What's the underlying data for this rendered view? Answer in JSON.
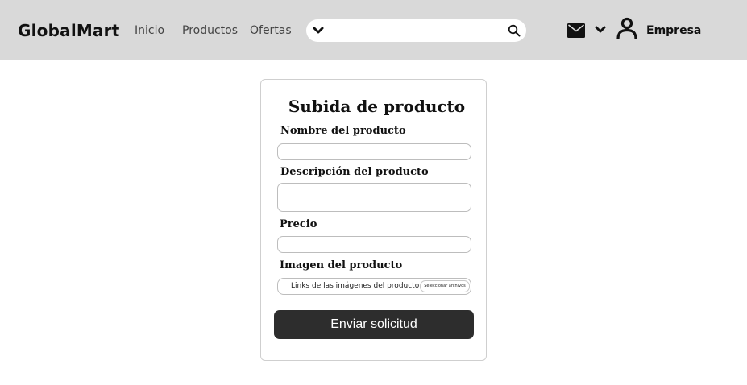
{
  "header": {
    "brand": "GlobalMart",
    "nav": [
      "Inicio",
      "Productos",
      "Ofertas"
    ],
    "search": {
      "placeholder": "",
      "value": "",
      "icons": [
        "chevron-down-icon",
        "search-icon"
      ]
    },
    "icons": [
      "mail-icon",
      "chevron-down-icon",
      "user-icon"
    ],
    "user_label": "Empresa"
  },
  "form": {
    "title": "Subida de producto",
    "fields": {
      "name": {
        "label": "Nombre del producto",
        "value": ""
      },
      "description": {
        "label": "Descripción del producto",
        "value": ""
      },
      "price": {
        "label": "Precio",
        "value": ""
      },
      "image": {
        "label": "Imagen del producto",
        "placeholder": "Links de las imágenes del producto",
        "button": "Seleccionar archivos"
      }
    },
    "submit": "Enviar solicitud"
  },
  "colors": {
    "header_bg": "#d9d9d9",
    "button_bg": "#2d2d2d",
    "button_text": "#ffffff",
    "border": "#cfcfcf"
  }
}
